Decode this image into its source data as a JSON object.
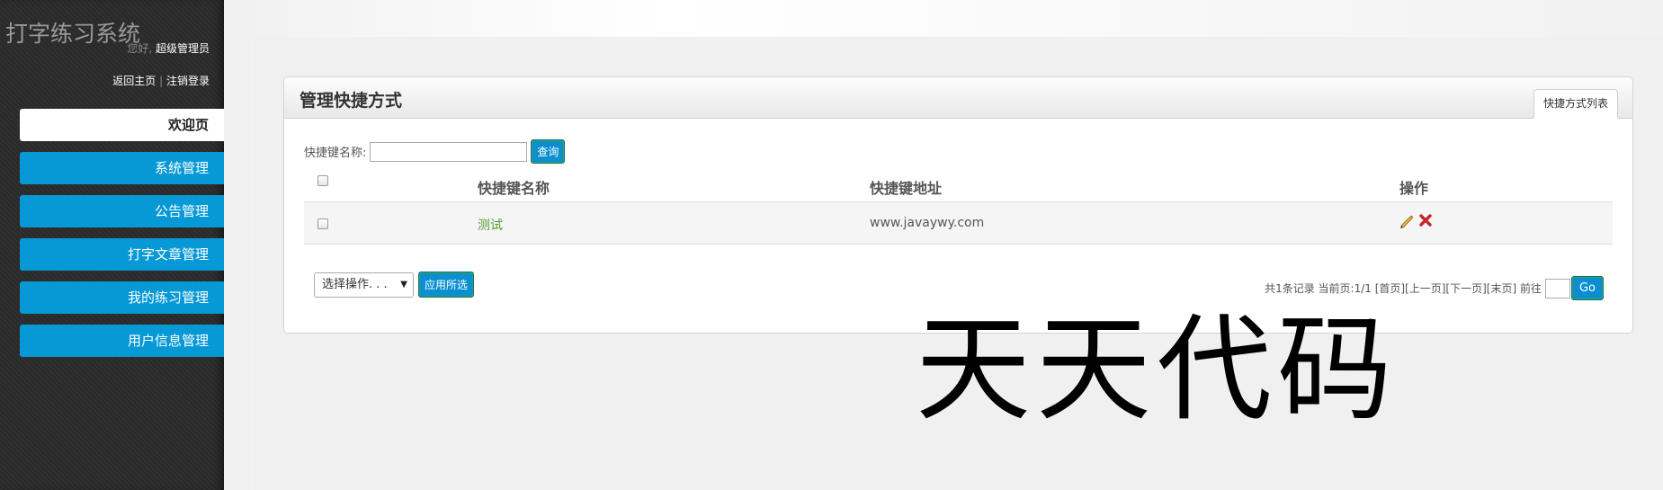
{
  "app": {
    "title": "打字练习系统",
    "greeting_prefix": "您好,",
    "username": "超级管理员",
    "link_home": "返回主页",
    "link_sep": "|",
    "link_logout": "注销登录"
  },
  "sidebar": {
    "items": [
      {
        "label": "欢迎页",
        "active": true
      },
      {
        "label": "系统管理"
      },
      {
        "label": "公告管理"
      },
      {
        "label": "打字文章管理"
      },
      {
        "label": "我的练习管理"
      },
      {
        "label": "用户信息管理"
      }
    ]
  },
  "panel": {
    "title": "管理快捷方式",
    "tab": "快捷方式列表"
  },
  "search": {
    "label": "快捷键名称:",
    "value": "",
    "button": "查询"
  },
  "table": {
    "headers": [
      "快捷键名称",
      "快捷键地址",
      "操作"
    ],
    "rows": [
      {
        "name": "测试",
        "address": "www.javaywy.com"
      }
    ]
  },
  "bulk": {
    "select_value": "选择操作. . .",
    "apply": "应用所选"
  },
  "pager": {
    "text": "共1条记录 当前页:1/1 [首页][上一页][下一页][末页] 前往",
    "go": "Go"
  },
  "watermark": {
    "line1": "天天代码",
    "line2": "码"
  },
  "colors": {
    "accent": "#0699d6",
    "sidebar_bg": "#2b2b2b",
    "link_green": "#5a9a2a"
  },
  "icons": {
    "edit": "pencil-icon",
    "delete": "cross-icon"
  }
}
